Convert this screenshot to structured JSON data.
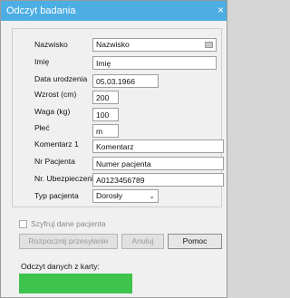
{
  "window": {
    "title": "Odczyt badania",
    "close_glyph": "×"
  },
  "form": {
    "fields": [
      {
        "label": "Nazwisko",
        "value": "Nazwisko"
      },
      {
        "label": "Imię",
        "value": "Imię"
      },
      {
        "label": "Data urodzenia",
        "value": "05.03.1966"
      },
      {
        "label": "Wzrost (cm)",
        "value": "200"
      },
      {
        "label": "Waga (kg)",
        "value": "100"
      },
      {
        "label": "Płeć",
        "value": "m"
      },
      {
        "label": "Komentarz 1",
        "value": "Komentarz"
      },
      {
        "label": "Nr Pacjenta",
        "value": "Numer pacjenta"
      },
      {
        "label": "Nr. Ubezpieczenia",
        "value": "A0123456789"
      }
    ],
    "patient_type": {
      "label": "Typ pacjenta",
      "value": "Dorosły"
    }
  },
  "encrypt": {
    "label": "Szyfruj dane pacjenta",
    "checked": false
  },
  "buttons": {
    "start": "Rozpocznij przesyłanie",
    "cancel": "Anuluj",
    "help": "Pomoc"
  },
  "card_read": {
    "label": "Odczyt danych z karty:",
    "status_color": "#3ec44d"
  },
  "colors": {
    "titlebar": "#4caee3",
    "status": "#3ec44d"
  }
}
